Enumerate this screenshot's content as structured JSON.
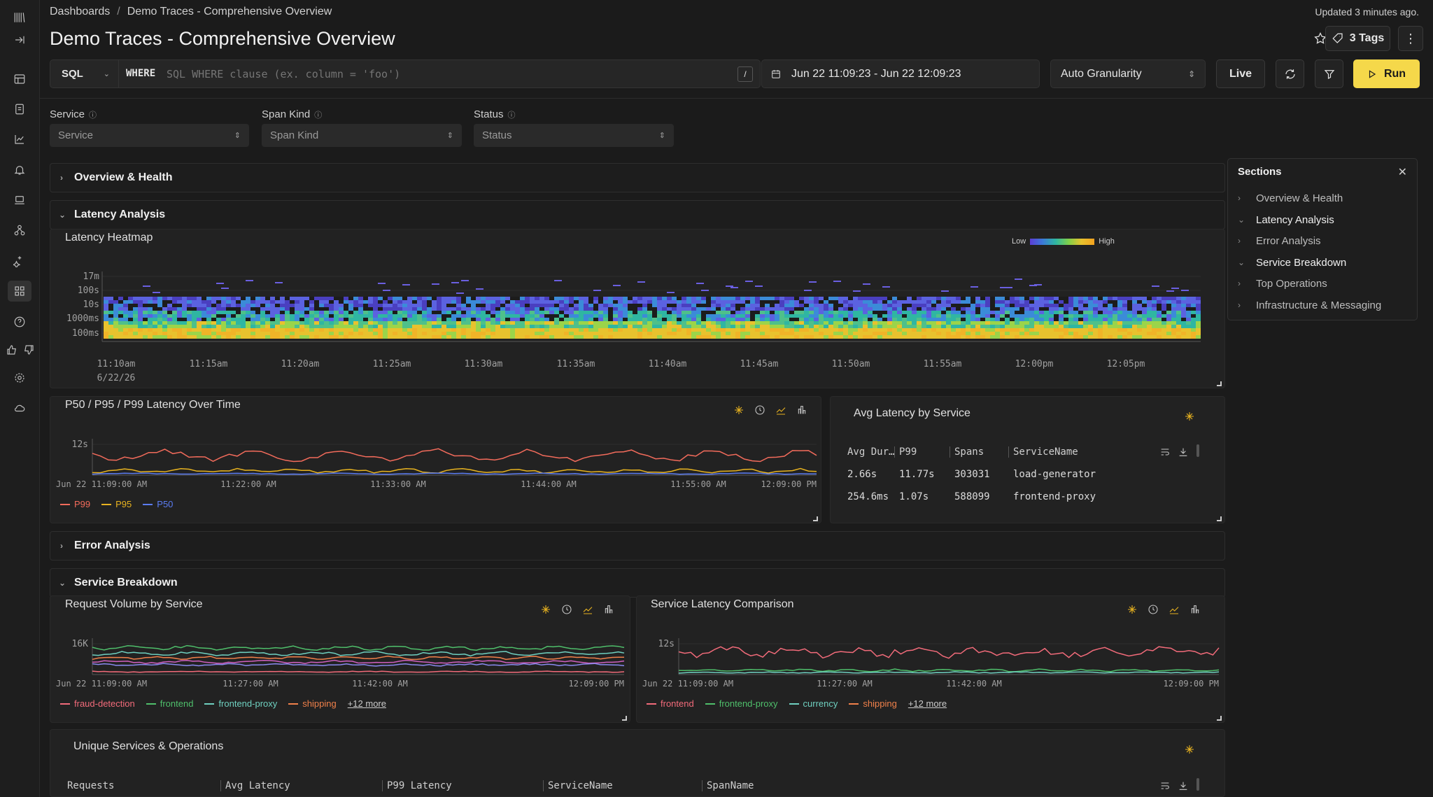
{
  "breadcrumb": {
    "root": "Dashboards",
    "sep": "/",
    "current": "Demo Traces - Comprehensive Overview"
  },
  "updated": "Updated 3 minutes ago.",
  "title": "Demo Traces - Comprehensive Overview",
  "tags_label": "3 Tags",
  "query": {
    "lang": "SQL",
    "where": "WHERE",
    "placeholder": "SQL WHERE clause (ex. column = 'foo')",
    "slash": "/"
  },
  "time_range": "Jun 22 11:09:23 - Jun 22 12:09:23",
  "granularity": "Auto Granularity",
  "live": "Live",
  "run": "Run",
  "filters": [
    {
      "label": "Service",
      "placeholder": "Service"
    },
    {
      "label": "Span Kind",
      "placeholder": "Span Kind"
    },
    {
      "label": "Status",
      "placeholder": "Status"
    }
  ],
  "sections": {
    "overview": "Overview & Health",
    "latency": "Latency Analysis",
    "error": "Error Analysis",
    "service": "Service Breakdown"
  },
  "heatmap": {
    "title": "Latency Heatmap",
    "legend_low": "Low",
    "legend_high": "High",
    "y_ticks": [
      "17m",
      "100s",
      "10s",
      "1000ms",
      "100ms"
    ],
    "x_ticks": [
      "11:10am",
      "11:15am",
      "11:20am",
      "11:25am",
      "11:30am",
      "11:35am",
      "11:40am",
      "11:45am",
      "11:50am",
      "11:55am",
      "12:00pm",
      "12:05pm"
    ],
    "date": "6/22/26"
  },
  "p_chart": {
    "title": "P50 / P95 / P99 Latency Over Time",
    "y_tick": "12s",
    "x_ticks": [
      "Jun 22 11:09:00 AM",
      "11:22:00 AM",
      "11:33:00 AM",
      "11:44:00 AM",
      "11:55:00 AM",
      "12:09:00 PM"
    ],
    "legend": [
      {
        "name": "P99",
        "color": "#f26b5b"
      },
      {
        "name": "P95",
        "color": "#e8b320"
      },
      {
        "name": "P50",
        "color": "#5b7cf2"
      }
    ]
  },
  "avg_table": {
    "title": "Avg Latency by Service",
    "columns": [
      "Avg Dur…",
      "P99",
      "Spans",
      "ServiceName"
    ],
    "rows": [
      [
        "2.66s",
        "11.77s",
        "303031",
        "load-generator"
      ],
      [
        "254.6ms",
        "1.07s",
        "588099",
        "frontend-proxy"
      ]
    ]
  },
  "req_chart": {
    "title": "Request Volume by Service",
    "y_tick": "16K",
    "x_ticks": [
      "Jun 22 11:09:00 AM",
      "11:27:00 AM",
      "11:42:00 AM",
      "12:09:00 PM"
    ],
    "legend": [
      {
        "name": "fraud-detection",
        "color": "#f26b7a"
      },
      {
        "name": "frontend",
        "color": "#4fbf6b"
      },
      {
        "name": "frontend-proxy",
        "color": "#6fd0c0"
      },
      {
        "name": "shipping",
        "color": "#f0804a"
      }
    ],
    "more": "+12 more"
  },
  "svc_chart": {
    "title": "Service Latency Comparison",
    "y_tick": "12s",
    "x_ticks": [
      "Jun 22 11:09:00 AM",
      "11:27:00 AM",
      "11:42:00 AM",
      "12:09:00 PM"
    ],
    "legend": [
      {
        "name": "frontend",
        "color": "#f26b7a"
      },
      {
        "name": "frontend-proxy",
        "color": "#4fbf6b"
      },
      {
        "name": "currency",
        "color": "#6fd0c0"
      },
      {
        "name": "shipping",
        "color": "#f0804a"
      }
    ],
    "more": "+12 more"
  },
  "ops_table": {
    "title": "Unique Services & Operations",
    "columns": [
      "Requests",
      "Avg Latency",
      "P99 Latency",
      "ServiceName",
      "SpanName"
    ]
  },
  "side": {
    "title": "Sections",
    "items": [
      {
        "label": "Overview & Health",
        "open": false
      },
      {
        "label": "Latency Analysis",
        "open": true
      },
      {
        "label": "Error Analysis",
        "open": false
      },
      {
        "label": "Service Breakdown",
        "open": true
      },
      {
        "label": "Top Operations",
        "open": false
      },
      {
        "label": "Infrastructure & Messaging",
        "open": false
      }
    ]
  }
}
